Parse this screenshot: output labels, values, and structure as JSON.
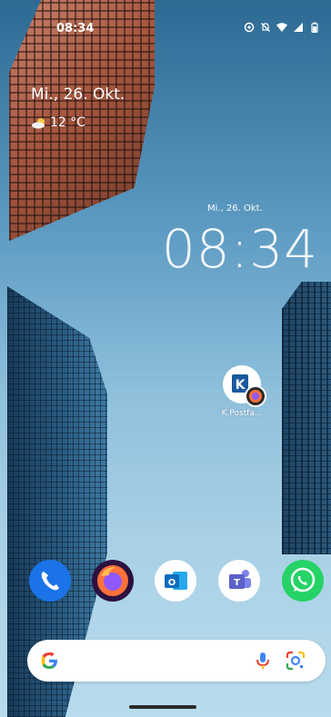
{
  "status_bar": {
    "time": "08:34",
    "icons": [
      "cast-icon",
      "bell-off-icon",
      "wifi-icon",
      "signal-icon",
      "battery-icon"
    ]
  },
  "glance": {
    "date": "Mi., 26. Okt.",
    "weather_icon": "partly-cloudy-icon",
    "temperature": "12 °C"
  },
  "clock_widget": {
    "date": "Mi., 26. Okt.",
    "time": "08:34"
  },
  "home_apps": [
    {
      "label": "K.Postfa...",
      "icon": "kpostfach-icon"
    }
  ],
  "dock": [
    {
      "icon": "phone-icon",
      "color": "#1a73e8"
    },
    {
      "icon": "firefox-icon",
      "color": "#ff7139"
    },
    {
      "icon": "outlook-icon",
      "color": "#0f6cbd"
    },
    {
      "icon": "teams-icon",
      "color": "#5b5fc7"
    },
    {
      "icon": "whatsapp-icon",
      "color": "#25d366"
    }
  ],
  "search_bar": {
    "logo": "G",
    "icons": [
      "microphone-icon",
      "google-lens-icon"
    ]
  }
}
